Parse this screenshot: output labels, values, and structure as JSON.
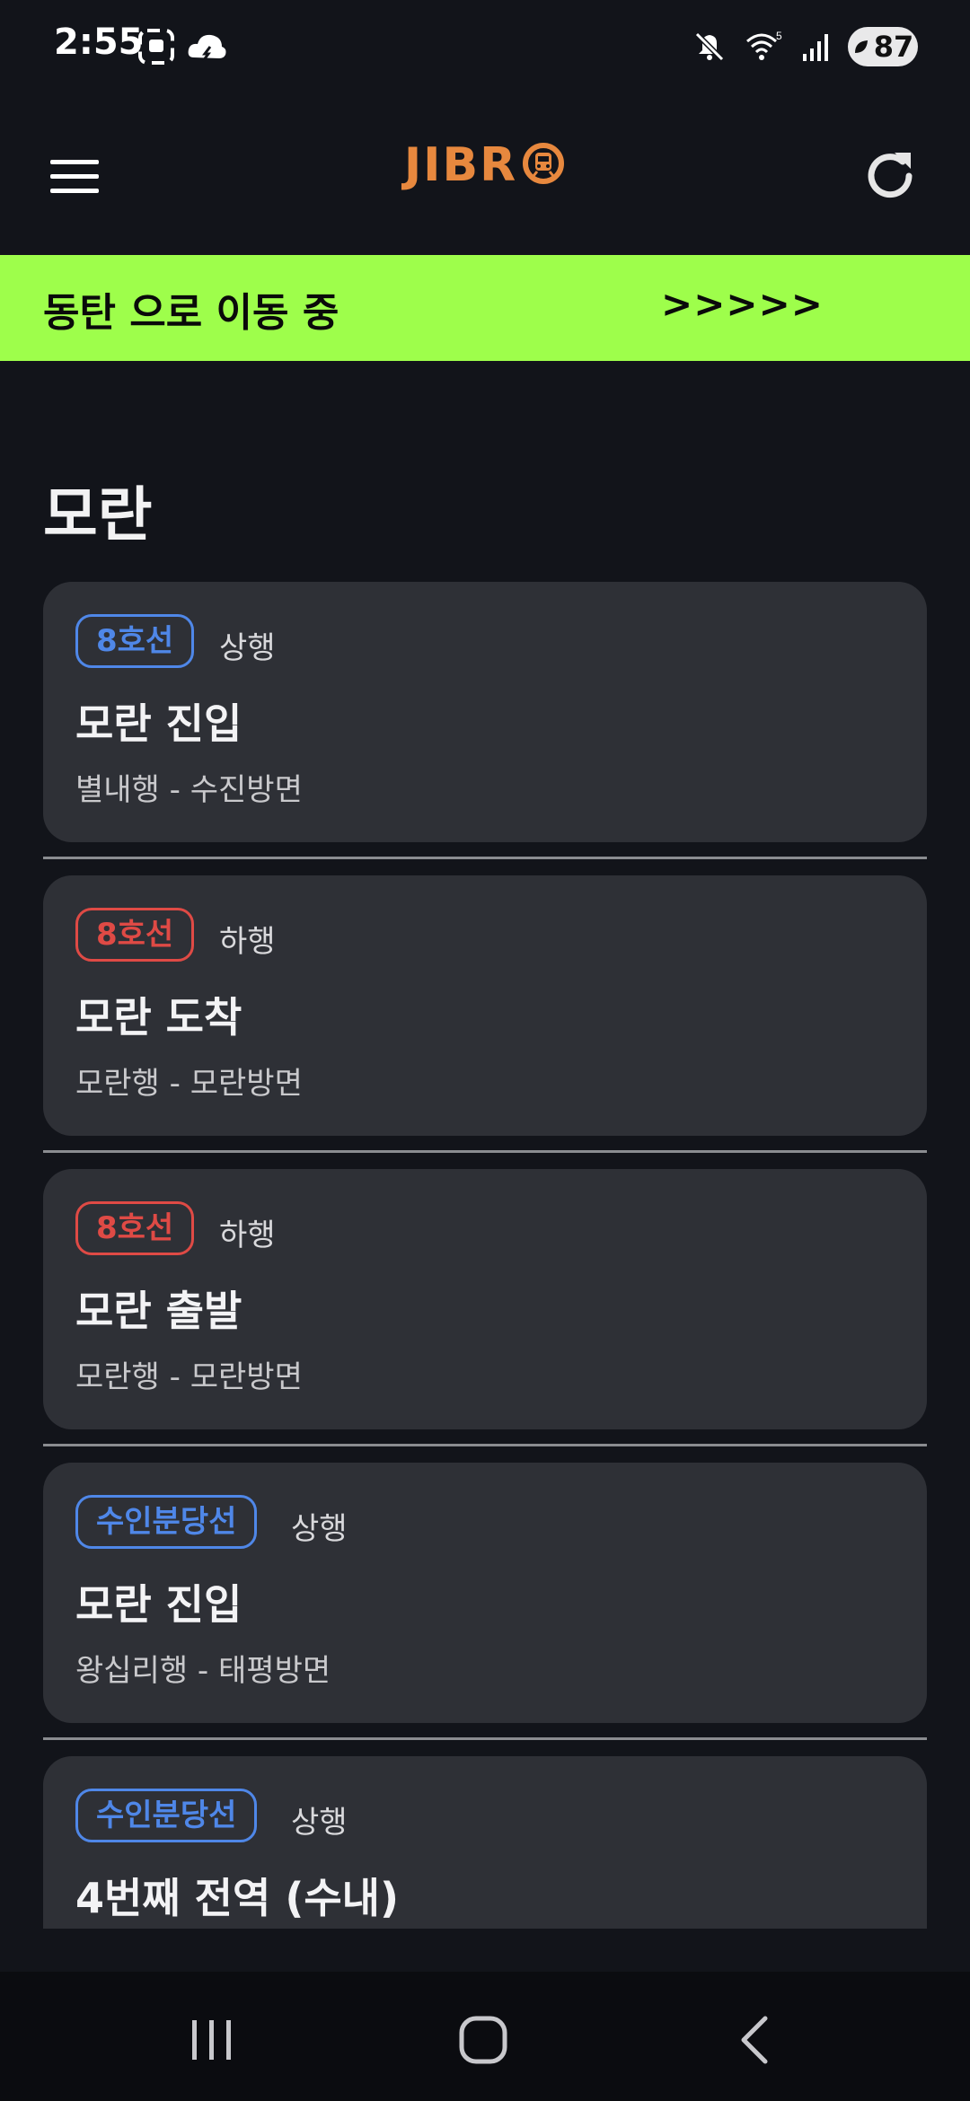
{
  "status_bar": {
    "time": "2:55",
    "left_icons": [
      "screenshot-icon",
      "weather-icon"
    ],
    "right_icons": [
      "mute-icon",
      "wifi-icon",
      "signal-icon"
    ],
    "battery": "87"
  },
  "app_bar": {
    "menu_icon": "hamburger-menu-icon",
    "logo": "JIBR",
    "refresh_icon": "refresh-icon"
  },
  "banner": {
    "text": "동탄 으로 이동 중",
    "arrows": ">>>>>",
    "color": "#9efe4b"
  },
  "section": {
    "title": "모란"
  },
  "cards": [
    {
      "line": "8호선",
      "line_color": "#4f87e8",
      "direction": "상행",
      "title": "모란 진입",
      "subtitle": "별내행 - 수진방면"
    },
    {
      "line": "8호선",
      "line_color": "#df4a45",
      "direction": "하행",
      "title": "모란 도착",
      "subtitle": "모란행 - 모란방면"
    },
    {
      "line": "8호선",
      "line_color": "#df4a45",
      "direction": "하행",
      "title": "모란 출발",
      "subtitle": "모란행 - 모란방면"
    },
    {
      "line": "수인분당선",
      "line_color": "#4f87e8",
      "direction": "상행",
      "title": "모란 진입",
      "subtitle": "왕십리행 - 태평방면"
    },
    {
      "line": "수인분당선",
      "line_color": "#4f87e8",
      "direction": "상행",
      "title": "4번째 전역 (수내)",
      "subtitle": ""
    }
  ],
  "nav_bar": {
    "icons": [
      "recent-apps-icon",
      "home-icon",
      "back-icon"
    ]
  }
}
